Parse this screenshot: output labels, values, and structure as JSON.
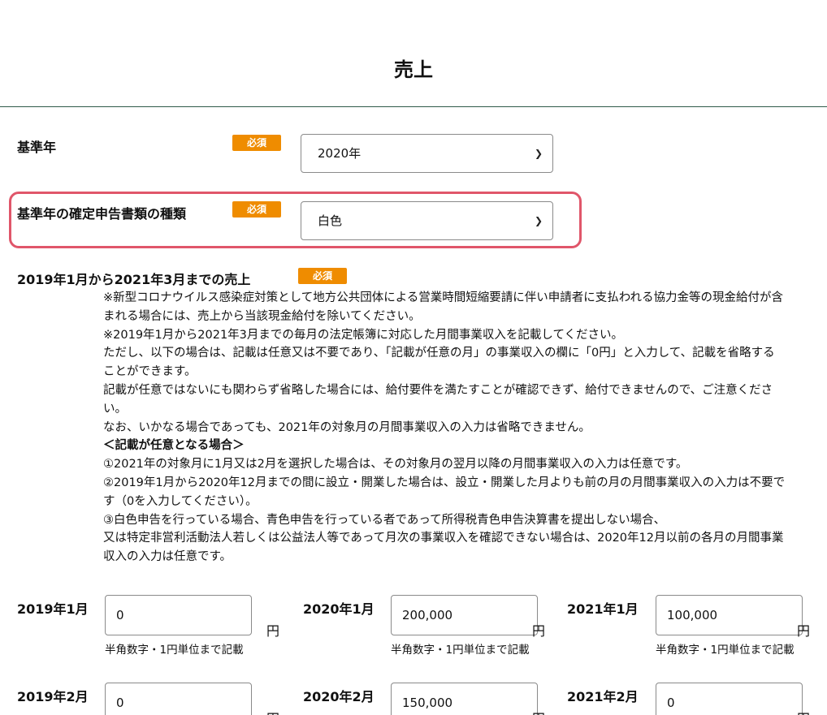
{
  "header": {
    "title": "売上"
  },
  "required_badge": "必須",
  "base_year": {
    "label": "基準年",
    "value": "2020年"
  },
  "tax_return_type": {
    "label": "基準年の確定申告書類の種類",
    "value": "白色"
  },
  "sales_section": {
    "label": "2019年1月から2021年3月までの売上",
    "notes": [
      "※新型コロナウイルス感染症対策として地方公共団体による営業時間短縮要請に伴い申請者に支払われる協力金等の現金給付が含",
      "まれる場合には、売上から当該現金給付を除いてください。",
      "※2019年1月から2021年3月までの毎月の法定帳簿に対応した月間事業収入を記載してください。",
      "ただし、以下の場合は、記載は任意又は不要であり、「記載が任意の月」の事業収入の欄に「0円」と入力して、記載を省略する",
      "ことができます。",
      "記載が任意ではないにも関わらず省略した場合には、給付要件を満たすことが確認できず、給付できませんので、ご注意くださ",
      "い。",
      "なお、いかなる場合であっても、2021年の対象月の月間事業収入の入力は省略できません。",
      "＜記載が任意となる場合＞",
      "①2021年の対象月に1月又は2月を選択した場合は、その対象月の翌月以降の月間事業収入の入力は任意です。",
      "②2019年1月から2020年12月までの間に設立・開業した場合は、設立・開業した月よりも前の月の月間事業収入の入力は不要で",
      "す（0を入力してください）。",
      "③白色申告を行っている場合、青色申告を行っている者であって所得税青色申告決算書を提出しない場合、",
      "又は特定非営利活動法人若しくは公益法人等であって月次の事業収入を確認できない場合は、2020年12月以前の各月の月間事業",
      "収入の入力は任意です。"
    ]
  },
  "yen": "円",
  "hint": "半角数字・1円単位まで記載",
  "months": [
    {
      "label": "2019年1月",
      "value": "0"
    },
    {
      "label": "2020年1月",
      "value": "200,000"
    },
    {
      "label": "2021年1月",
      "value": "100,000"
    },
    {
      "label": "2019年2月",
      "value": "0"
    },
    {
      "label": "2020年2月",
      "value": "150,000"
    },
    {
      "label": "2021年2月",
      "value": "0"
    }
  ]
}
